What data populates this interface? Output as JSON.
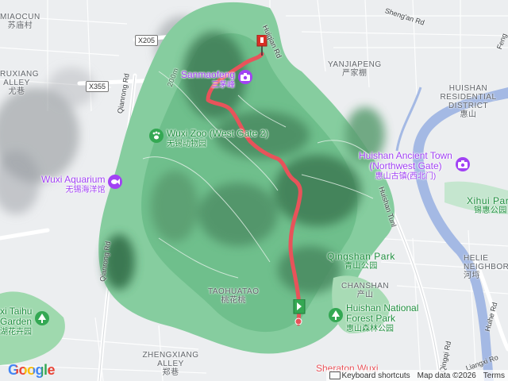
{
  "labels": {
    "miaocun": {
      "en": "MIAOCUN",
      "cn": "苏庙村"
    },
    "ruxiang": {
      "en": "RUXIANG ALLEY",
      "cn": "尤巷"
    },
    "yanjiapeng": {
      "en": "YANJIAPENG",
      "cn": "严家棚"
    },
    "huishan_res": {
      "en": "HUISHAN RESIDENTIAL DISTRICT",
      "cn": "惠山"
    },
    "taohuatao": {
      "en": "TAOHUATAO",
      "cn": "桃花桃"
    },
    "chanshan": {
      "en": "CHANSHAN",
      "cn": "产山"
    },
    "zhengxiang": {
      "en": "ZHENGXIANG ALLEY",
      "cn": "郑巷"
    },
    "helie": {
      "en": "HELIE NEIGHBORHO",
      "cn": "河埒"
    },
    "xihui_park": {
      "en": "Xihui Park",
      "cn": "锡惠公园"
    },
    "qingshan_park": {
      "en": "Qingshan Park",
      "cn": "青山公园"
    }
  },
  "pois": {
    "sanmao": {
      "en": "Sanmaofeng",
      "cn": "三茅峰",
      "icon": "camera-icon"
    },
    "zoo": {
      "en": "Wuxi Zoo (West Gate 2)",
      "cn": "无锡动物园",
      "icon": "paw-icon"
    },
    "aquarium": {
      "en": "Wuxi Aquarium",
      "cn": "无锡海洋馆",
      "icon": "fish-icon"
    },
    "ancient_town": {
      "en": "Huishan Ancient Town (Northwest Gate)",
      "en1": "Huishan Ancient Town",
      "en2": "(Northwest Gate)",
      "cn": "惠山古镇(西北门)",
      "icon": "camera-icon"
    },
    "forest_park": {
      "en": "Huishan National Forest Park",
      "en1": "Huishan National",
      "en2": "Forest Park",
      "cn": "惠山森林公园",
      "icon": "tree-icon"
    },
    "taihu_garden": {
      "en": "xi Taihu Garden",
      "en1": "xi Taihu",
      "en2": "Garden",
      "cn": "湖花卉园",
      "icon": "tree-icon"
    },
    "sheraton": {
      "en": "Sheraton Wuxi"
    }
  },
  "roads": {
    "huiqian": "Huiqian Rd",
    "shengan": "Sheng'an Rd",
    "qianrong1": "Qianrong Rd",
    "qianrong2": "Qianrong Rd",
    "huishan_tunl": "Huishan Tunl",
    "qingqi": "Qingqi Rd",
    "huihe": "Huihe Rd",
    "liangxi": "Liangxi Ro",
    "feng": "Feng",
    "x205": "X205",
    "x355": "X355",
    "contour200": "200m"
  },
  "footer": {
    "keyboard": "Keyboard shortcuts",
    "mapdata": "Map data ©2026",
    "terms": "Terms"
  },
  "branding": {
    "google": "Google"
  },
  "colors": {
    "route": "#e8535a",
    "forest": "#7ec79a",
    "water": "#9ab2de",
    "start_marker": "#34a853",
    "end_marker": "#d93025"
  }
}
